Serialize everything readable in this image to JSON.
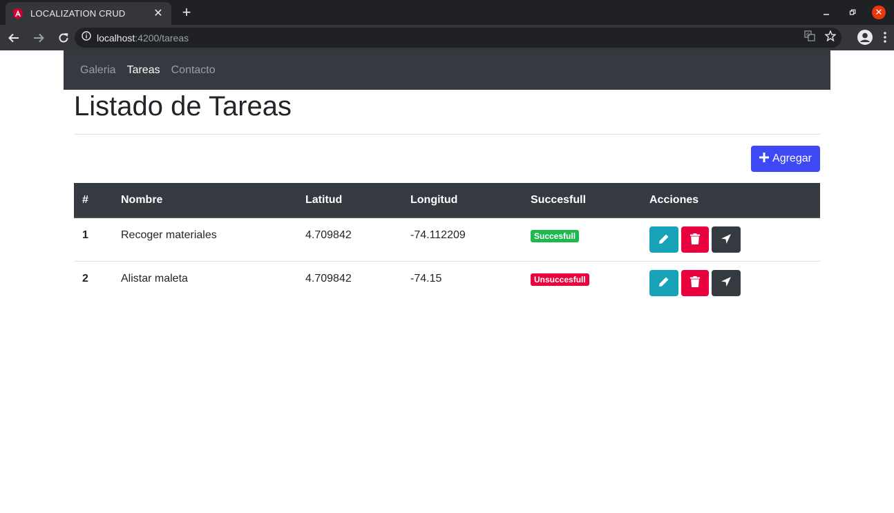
{
  "browser": {
    "tab_title": "LOCALIZATION CRUD",
    "new_tab_symbol": "+",
    "url_host": "localhost",
    "url_path": ":4200/tareas"
  },
  "navbar": {
    "links": [
      {
        "label": "Galeria",
        "active": false
      },
      {
        "label": "Tareas",
        "active": true
      },
      {
        "label": "Contacto",
        "active": false
      }
    ]
  },
  "page": {
    "title": "Listado de Tareas",
    "add_button_label": "Agregar"
  },
  "table": {
    "headers": [
      "#",
      "Nombre",
      "Latitud",
      "Longitud",
      "Succesfull",
      "Acciones"
    ],
    "rows": [
      {
        "index": "1",
        "nombre": "Recoger materiales",
        "latitud": "4.709842",
        "longitud": "-74.112209",
        "status": "Succesfull",
        "status_type": "ok"
      },
      {
        "index": "2",
        "nombre": "Alistar maleta",
        "latitud": "4.709842",
        "longitud": "-74.15",
        "status": "Unsuccesfull",
        "status_type": "bad"
      }
    ]
  },
  "colors": {
    "navbar_bg": "#343a40",
    "primary_button": "#3f48f5",
    "edit_button": "#17a2b8",
    "delete_button": "#e8033f",
    "locate_button": "#343a40",
    "success_badge": "#1fb850",
    "fail_badge": "#e8033f"
  },
  "icons": {
    "favicon": "angular-icon",
    "edit": "pencil-icon",
    "delete": "trash-icon",
    "locate": "location-arrow-icon",
    "add": "plus-icon"
  }
}
